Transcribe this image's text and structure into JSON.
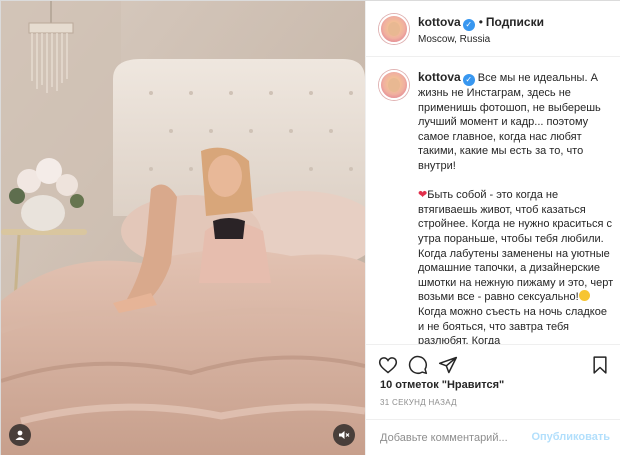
{
  "post": {
    "username": "kottova",
    "follow_label": "Подписки",
    "separator": "•",
    "location": "Moscow, Russia",
    "caption": {
      "paragraph1": "Все мы не идеальны. А жизнь не Инстаграм, здесь не применишь фотошоп, не выберешь лучший момент и кадр... поэтому самое главное, когда нас любят такими, какие мы есть за то, что внутри!",
      "paragraph2_before_smile": "Быть собой - это когда не втягиваешь живот, чтоб казаться стройнее. Когда не нужно краситься с утра пораньше, чтобы тебя любили. Когда лабутены заменены на уютные домашние тапочки, а дизайнерские шмотки на нежную пижаму и это, черт возьми все - равно сексуально!",
      "paragraph2_after_smile": "Когда можно съесть на ночь сладкое и не бояться, что завтра тебя разлюбят. Когда"
    },
    "likes": "10 отметок \"Нравится\"",
    "timestamp": "31 СЕКУНД НАЗАД",
    "comment_placeholder": "Добавьте комментарий...",
    "publish_label": "Опубликовать"
  },
  "icons": {
    "verified": "verified-badge-icon",
    "heart": "heart-icon",
    "comment": "comment-icon",
    "share": "share-icon",
    "bookmark": "bookmark-icon",
    "volume_off": "volume-off-icon",
    "tag_people": "tag-people-icon",
    "caption_heart_emoji": "red-heart-emoji",
    "caption_smile_emoji": "smile-emoji"
  },
  "colors": {
    "verified": "#3897f0",
    "publish_disabled": "#b2dffc",
    "caption_heart": "#e1304c",
    "muted_text": "#8e8e8e"
  }
}
